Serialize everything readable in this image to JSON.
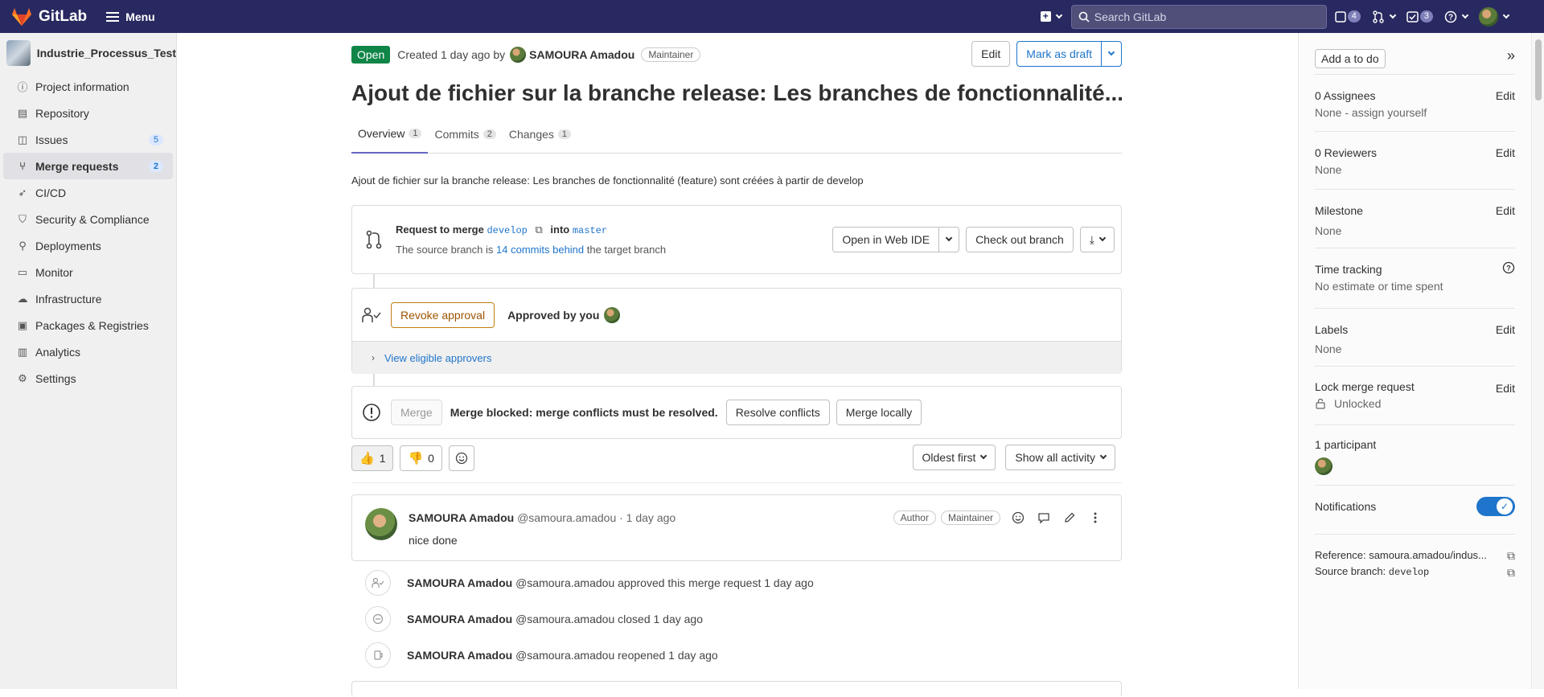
{
  "topbar": {
    "brand": "GitLab",
    "menu_label": "Menu",
    "search_placeholder": "Search GitLab",
    "issues_count": "4",
    "todos_count": "3",
    "brand_color": "#292961"
  },
  "sidebar": {
    "project_name": "Industrie_Processus_Test",
    "items": [
      {
        "label": "Project information",
        "icon": "info-icon"
      },
      {
        "label": "Repository",
        "icon": "document-icon"
      },
      {
        "label": "Issues",
        "icon": "issues-icon",
        "badge": "5"
      },
      {
        "label": "Merge requests",
        "icon": "merge-request-icon",
        "badge": "2"
      },
      {
        "label": "CI/CD",
        "icon": "rocket-icon"
      },
      {
        "label": "Security & Compliance",
        "icon": "shield-icon"
      },
      {
        "label": "Deployments",
        "icon": "deployments-icon"
      },
      {
        "label": "Monitor",
        "icon": "monitor-icon"
      },
      {
        "label": "Infrastructure",
        "icon": "cloud-icon"
      },
      {
        "label": "Packages & Registries",
        "icon": "package-icon"
      },
      {
        "label": "Analytics",
        "icon": "chart-icon"
      },
      {
        "label": "Settings",
        "icon": "gear-icon"
      }
    ]
  },
  "mr": {
    "status": "Open",
    "created_text": "Created 1 day ago by",
    "author": "SAMOURA Amadou",
    "role": "Maintainer",
    "edit_label": "Edit",
    "draft_label": "Mark as draft",
    "title": "Ajout de fichier sur la branche release: Les branches de fonctionnalité...",
    "tabs": [
      {
        "label": "Overview",
        "count": "1"
      },
      {
        "label": "Commits",
        "count": "2"
      },
      {
        "label": "Changes",
        "count": "1"
      }
    ],
    "description": "Ajout de fichier sur la branche release: Les branches de fonctionnalité (feature) sont créées à partir de develop"
  },
  "merge_box": {
    "request_to_merge": "Request to merge",
    "source": "develop",
    "into": "into",
    "target": "master",
    "behind_prefix": "The source branch is",
    "behind_link": "14 commits behind",
    "behind_suffix": "the target branch",
    "web_ide": "Open in Web IDE",
    "checkout": "Check out branch"
  },
  "approval": {
    "revoke": "Revoke approval",
    "approved_by": "Approved by you",
    "eligible": "View eligible approvers"
  },
  "blocked": {
    "merge": "Merge",
    "text": "Merge blocked: merge conflicts must be resolved.",
    "resolve": "Resolve conflicts",
    "locally": "Merge locally"
  },
  "reactions": {
    "thumbs_up": "1",
    "thumbs_down": "0",
    "sort": "Oldest first",
    "filter": "Show all activity"
  },
  "note": {
    "author": "SAMOURA Amadou",
    "handle_time": "@samoura.amadou · 1 day ago",
    "author_badge": "Author",
    "role_badge": "Maintainer",
    "text": "nice done"
  },
  "activity": [
    {
      "author": "SAMOURA Amadou",
      "text": "@samoura.amadou approved this merge request 1 day ago",
      "icon": "approval-icon"
    },
    {
      "author": "SAMOURA Amadou",
      "text": "@samoura.amadou closed 1 day ago",
      "icon": "closed-icon"
    },
    {
      "author": "SAMOURA Amadou",
      "text": "@samoura.amadou reopened 1 day ago",
      "icon": "reopened-icon"
    }
  ],
  "rightbar": {
    "add_todo": "Add a to do",
    "assignees_title": "0 Assignees",
    "assignees_val": "None - assign yourself",
    "reviewers_title": "0 Reviewers",
    "reviewers_val": "None",
    "milestone_title": "Milestone",
    "milestone_val": "None",
    "time_title": "Time tracking",
    "time_val": "No estimate or time spent",
    "labels_title": "Labels",
    "labels_val": "None",
    "lock_title": "Lock merge request",
    "lock_val": "Unlocked",
    "participants_title": "1 participant",
    "notifications_title": "Notifications",
    "reference": "Reference: samoura.amadou/indus...",
    "source_branch_label": "Source branch:",
    "source_branch_val": "develop",
    "edit": "Edit"
  }
}
